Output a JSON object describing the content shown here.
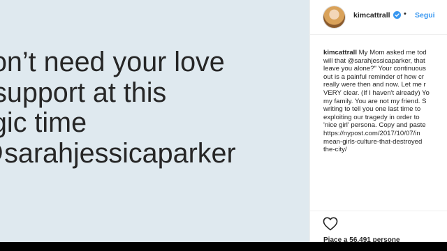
{
  "post_image": {
    "quote_lines": [
      "don’t need your love",
      "r support at this",
      "agic time",
      "@sarahjessicaparker"
    ]
  },
  "header": {
    "username": "kimcattrall",
    "follow_label": "Segui",
    "separator": "•",
    "avatar_icon": "profile-avatar",
    "verified_icon": "verified-badge-icon"
  },
  "caption": {
    "username": "kimcattrall",
    "first_line_text": " My Mom asked me tod",
    "lines": [
      "will that @sarahjessicaparker, that",
      "leave you alone?\" Your continuous",
      "out is a painful reminder of how cr",
      "really were then and now. Let me r",
      "VERY clear. (If I haven't already) Yo",
      "my family. You are not my friend. S",
      "writing to tell you one last time to",
      "exploiting our tragedy in order to",
      "'nice girl' persona. Copy and paste",
      "https://nypost.com/2017/10/07/in",
      "mean-girls-culture-that-destroyed",
      "the-city/"
    ]
  },
  "actions": {
    "like_icon": "heart-icon",
    "likes_text": "Piace a 56.491 persone"
  },
  "colors": {
    "image_bg": "#dfe9ef",
    "text": "#262626",
    "link_blue": "#3897f0"
  }
}
